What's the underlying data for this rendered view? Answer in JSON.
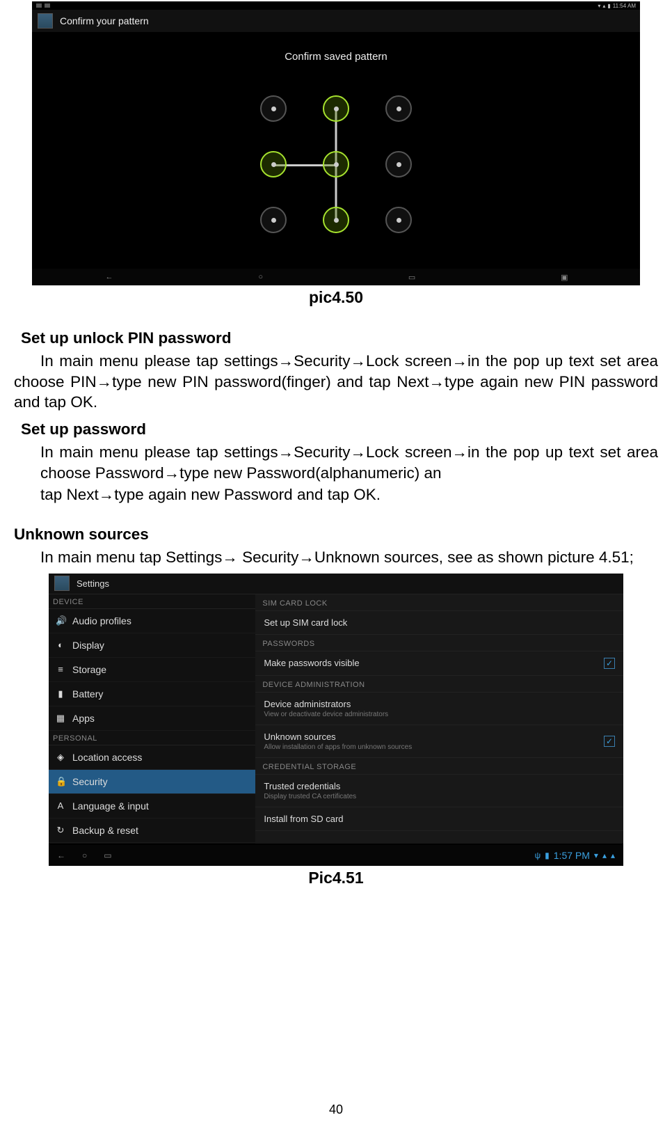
{
  "shot1": {
    "status_time": "11:54 AM",
    "header_title": "Confirm your pattern",
    "confirm_text": "Confirm saved pattern",
    "nav": {
      "back": "←",
      "home": "○",
      "recent": "▭",
      "share": "▣"
    }
  },
  "caption1": "pic4.50",
  "text": {
    "h_pin": "Set up unlock PIN password",
    "p_pin": "In main menu please tap settings→Security→Lock screen→in the pop up text set area choose PIN→type new PIN password(finger) and tap Next→type again new PIN password and tap OK.",
    "h_pwd": "Set up password",
    "p_pwd1": "In main menu please tap settings→Security→Lock screen→in the pop up text set area choose Password→type new Password(alphanumeric) an",
    "p_pwd2": "tap Next→type again new Password and tap OK.",
    "h_unk": "Unknown sources",
    "p_unk": "In main menu tap Settings→ Security→Unknown sources, see as shown picture 4.51;"
  },
  "shot2": {
    "header_title": "Settings",
    "side": {
      "header_device": "DEVICE",
      "items_device": [
        {
          "icon": "🔊",
          "label": "Audio profiles"
        },
        {
          "icon": "◐",
          "label": "Display"
        },
        {
          "icon": "≡",
          "label": "Storage"
        },
        {
          "icon": "▮",
          "label": "Battery"
        },
        {
          "icon": "▦",
          "label": "Apps"
        }
      ],
      "header_personal": "PERSONAL",
      "items_personal": [
        {
          "icon": "◈",
          "label": "Location access",
          "sel": false
        },
        {
          "icon": "🔒",
          "label": "Security",
          "sel": true
        },
        {
          "icon": "A",
          "label": "Language & input",
          "sel": false
        },
        {
          "icon": "↻",
          "label": "Backup & reset",
          "sel": false
        }
      ]
    },
    "main": {
      "s_sim": "SIM CARD LOCK",
      "r_sim": "Set up SIM card lock",
      "s_pwd": "PASSWORDS",
      "r_visible": "Make passwords visible",
      "s_admin": "DEVICE ADMINISTRATION",
      "r_admin_t": "Device administrators",
      "r_admin_s": "View or deactivate device administrators",
      "r_unk_t": "Unknown sources",
      "r_unk_s": "Allow installation of apps from unknown sources",
      "s_cred": "CREDENTIAL STORAGE",
      "r_trust_t": "Trusted credentials",
      "r_trust_s": "Display trusted CA certificates",
      "r_install": "Install from SD card"
    },
    "nav": {
      "back": "←",
      "home": "○",
      "recent": "▭",
      "time": "1:57 PM"
    }
  },
  "caption2": "Pic4.51",
  "page_number": "40"
}
